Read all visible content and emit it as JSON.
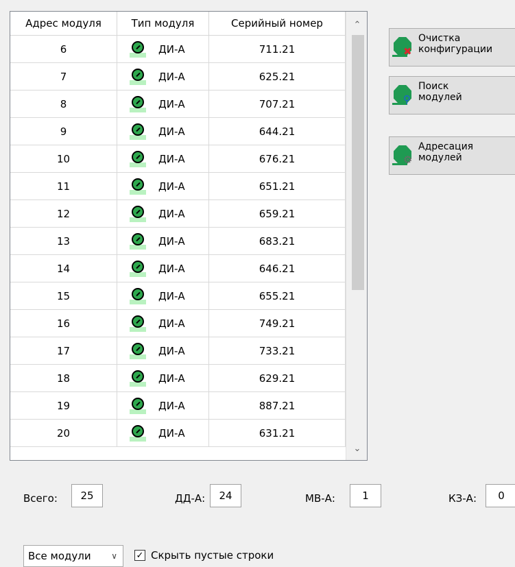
{
  "table": {
    "headers": [
      "Адрес модуля",
      "Тип модуля",
      "Серийный номер"
    ],
    "rows": [
      {
        "address": "6",
        "type": "ДИ-А",
        "serial": "711.21"
      },
      {
        "address": "7",
        "type": "ДИ-А",
        "serial": "625.21"
      },
      {
        "address": "8",
        "type": "ДИ-А",
        "serial": "707.21"
      },
      {
        "address": "9",
        "type": "ДИ-А",
        "serial": "644.21"
      },
      {
        "address": "10",
        "type": "ДИ-А",
        "serial": "676.21"
      },
      {
        "address": "11",
        "type": "ДИ-А",
        "serial": "651.21"
      },
      {
        "address": "12",
        "type": "ДИ-А",
        "serial": "659.21"
      },
      {
        "address": "13",
        "type": "ДИ-А",
        "serial": "683.21"
      },
      {
        "address": "14",
        "type": "ДИ-А",
        "serial": "646.21"
      },
      {
        "address": "15",
        "type": "ДИ-А",
        "serial": "655.21"
      },
      {
        "address": "16",
        "type": "ДИ-А",
        "serial": "749.21"
      },
      {
        "address": "17",
        "type": "ДИ-А",
        "serial": "733.21"
      },
      {
        "address": "18",
        "type": "ДИ-А",
        "serial": "629.21"
      },
      {
        "address": "19",
        "type": "ДИ-А",
        "serial": "887.21"
      },
      {
        "address": "20",
        "type": "ДИ-А",
        "serial": "631.21"
      }
    ],
    "sort_indicator": "^"
  },
  "actions": {
    "clear_config": "Очистка\nконфигурации",
    "search_modules": "Поиск\nмодулей",
    "address_modules": "Адресация\nмодулей"
  },
  "counters": {
    "total_label": "Всего:",
    "total_value": "25",
    "dd_label": "ДД-А:",
    "dd_value": "24",
    "mv_label": "МВ-А:",
    "mv_value": "1",
    "kz_label": "КЗ-А:",
    "kz_value": "0"
  },
  "filter": {
    "selected": "Все модули",
    "hide_empty_label": "Скрыть пустые строки",
    "hide_empty_checked": true
  },
  "icons": {
    "module_type": "module-status-icon",
    "clear": "clear-config-icon",
    "search": "search-modules-icon",
    "address": "address-modules-icon"
  },
  "colors": {
    "accent_green": "#1f9a52",
    "clear_badge": "#d9282f",
    "search_badge": "#1d5fd4",
    "gear_badge": "#6a6a6a"
  }
}
